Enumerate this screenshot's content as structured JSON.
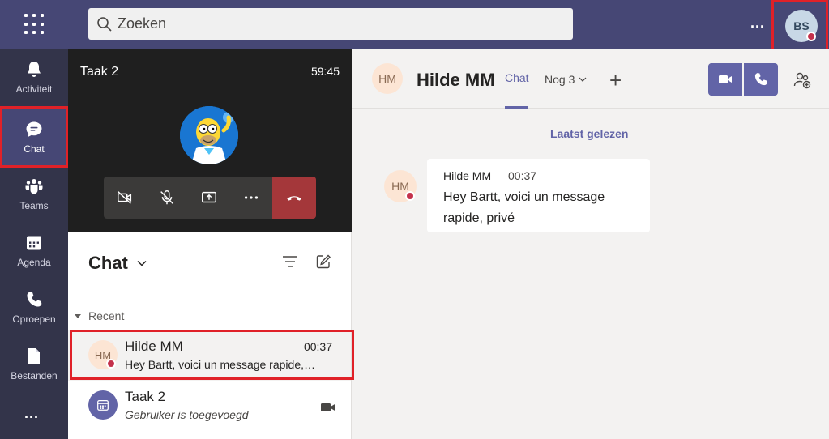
{
  "topbar": {
    "search_placeholder": "Zoeken",
    "more_label": "...",
    "user_initials": "BS"
  },
  "rail": {
    "items": [
      {
        "label": "Activiteit",
        "icon": "bell-icon"
      },
      {
        "label": "Chat",
        "icon": "chat-icon"
      },
      {
        "label": "Teams",
        "icon": "teams-icon"
      },
      {
        "label": "Agenda",
        "icon": "calendar-icon"
      },
      {
        "label": "Oproepen",
        "icon": "phone-icon"
      },
      {
        "label": "Bestanden",
        "icon": "file-icon"
      }
    ],
    "more_label": "...",
    "active": "Chat"
  },
  "call": {
    "title": "Taak 2",
    "timer": "59:45",
    "controls": [
      "camera-off-icon",
      "mic-off-icon",
      "share-screen-icon",
      "more-icon",
      "hang-up-icon"
    ]
  },
  "chatlist": {
    "title": "Chat",
    "section": "Recent",
    "rows": [
      {
        "initials": "HM",
        "name": "Hilde MM",
        "time": "00:37",
        "preview": "Hey Bartt, voici un message rapide, privé"
      },
      {
        "initials": "",
        "name": "Taak 2",
        "time": "",
        "preview": "Gebruiker is toegevoegd"
      }
    ]
  },
  "conversation": {
    "initials": "HM",
    "name": "Hilde MM",
    "active_tab": "Chat",
    "more_tabs": "Nog 3",
    "add_tab": "+",
    "divider_label": "Laatst gelezen",
    "message": {
      "initials": "HM",
      "author": "Hilde MM",
      "time": "00:37",
      "text": "Hey Bartt, voici un message rapide, privé"
    }
  },
  "colors": {
    "brand": "#6264a7",
    "topbar": "#464775",
    "rail": "#33344a",
    "presence_busy": "#c4314b",
    "hangup": "#a4373a",
    "highlight": "#e02128"
  }
}
